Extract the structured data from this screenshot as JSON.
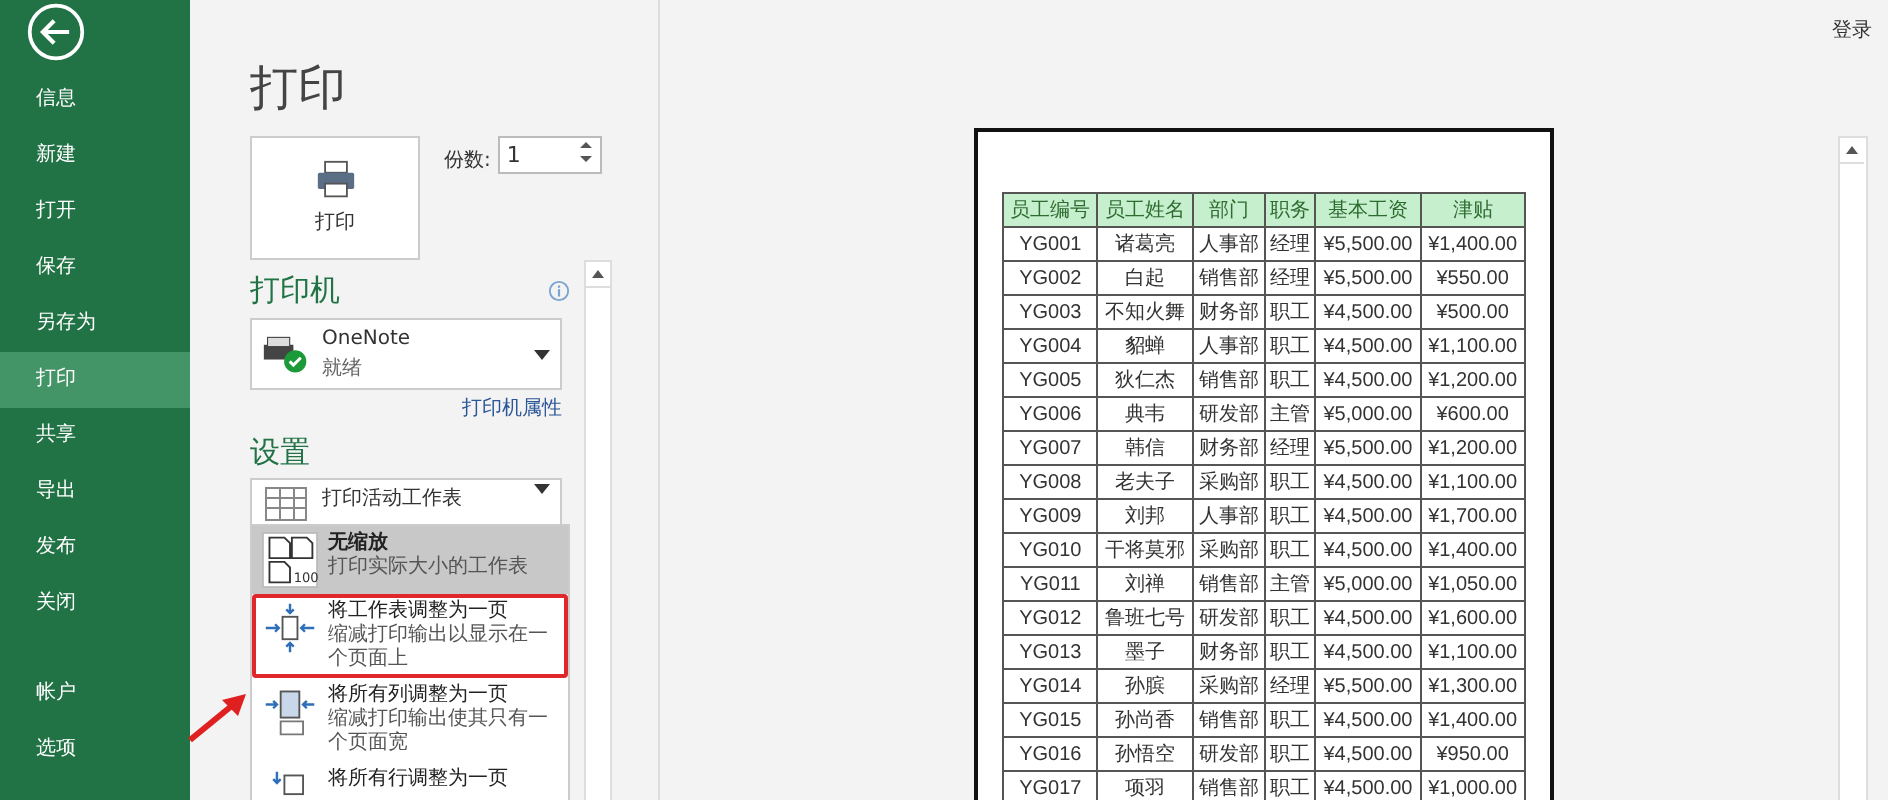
{
  "sidebar": {
    "items": [
      {
        "label": "信息",
        "selected": false
      },
      {
        "label": "新建",
        "selected": false
      },
      {
        "label": "打开",
        "selected": false
      },
      {
        "label": "保存",
        "selected": false
      },
      {
        "label": "另存为",
        "selected": false
      },
      {
        "label": "打印",
        "selected": true
      },
      {
        "label": "共享",
        "selected": false
      },
      {
        "label": "导出",
        "selected": false
      },
      {
        "label": "发布",
        "selected": false
      },
      {
        "label": "关闭",
        "selected": false
      }
    ],
    "bottom_items": [
      {
        "label": "帐户",
        "selected": false
      },
      {
        "label": "选项",
        "selected": false
      }
    ]
  },
  "header": {
    "title": "打印",
    "account": "登录"
  },
  "print_button": {
    "label": "打印"
  },
  "copies": {
    "label": "份数:",
    "value": "1"
  },
  "printer": {
    "heading": "打印机",
    "name": "OneNote",
    "status": "就绪",
    "properties_link": "打印机属性"
  },
  "settings": {
    "heading": "设置",
    "what_dropdown": {
      "title": "打印活动工作表"
    },
    "scaling_options": [
      {
        "kind": "none",
        "title": "无缩放",
        "description": "打印实际大小的工作表",
        "icon_label": "100",
        "selected": true,
        "highlighted": false
      },
      {
        "kind": "sheet",
        "title": "将工作表调整为一页",
        "description": "缩减打印输出以显示在一个页面上",
        "selected": false,
        "highlighted": true
      },
      {
        "kind": "columns",
        "title": "将所有列调整为一页",
        "description": "缩减打印输出使其只有一个页面宽",
        "selected": false,
        "highlighted": false
      },
      {
        "kind": "rows",
        "title": "将所有行调整为一页",
        "selected": false,
        "highlighted": false
      }
    ]
  },
  "preview": {
    "table": {
      "columns": [
        "员工编号",
        "员工姓名",
        "部门",
        "职务",
        "基本工资",
        "津贴"
      ],
      "rows": [
        [
          "YG001",
          "诸葛亮",
          "人事部",
          "经理",
          "¥5,500.00",
          "¥1,400.00"
        ],
        [
          "YG002",
          "白起",
          "销售部",
          "经理",
          "¥5,500.00",
          "¥550.00"
        ],
        [
          "YG003",
          "不知火舞",
          "财务部",
          "职工",
          "¥4,500.00",
          "¥500.00"
        ],
        [
          "YG004",
          "貂蝉",
          "人事部",
          "职工",
          "¥4,500.00",
          "¥1,100.00"
        ],
        [
          "YG005",
          "狄仁杰",
          "销售部",
          "职工",
          "¥4,500.00",
          "¥1,200.00"
        ],
        [
          "YG006",
          "典韦",
          "研发部",
          "主管",
          "¥5,000.00",
          "¥600.00"
        ],
        [
          "YG007",
          "韩信",
          "财务部",
          "经理",
          "¥5,500.00",
          "¥1,200.00"
        ],
        [
          "YG008",
          "老夫子",
          "采购部",
          "职工",
          "¥4,500.00",
          "¥1,100.00"
        ],
        [
          "YG009",
          "刘邦",
          "人事部",
          "职工",
          "¥4,500.00",
          "¥1,700.00"
        ],
        [
          "YG010",
          "干将莫邪",
          "采购部",
          "职工",
          "¥4,500.00",
          "¥1,400.00"
        ],
        [
          "YG011",
          "刘禅",
          "销售部",
          "主管",
          "¥5,000.00",
          "¥1,050.00"
        ],
        [
          "YG012",
          "鲁班七号",
          "研发部",
          "职工",
          "¥4,500.00",
          "¥1,600.00"
        ],
        [
          "YG013",
          "墨子",
          "财务部",
          "职工",
          "¥4,500.00",
          "¥1,100.00"
        ],
        [
          "YG014",
          "孙膑",
          "采购部",
          "经理",
          "¥5,500.00",
          "¥1,300.00"
        ],
        [
          "YG015",
          "孙尚香",
          "销售部",
          "职工",
          "¥4,500.00",
          "¥1,400.00"
        ],
        [
          "YG016",
          "孙悟空",
          "研发部",
          "职工",
          "¥4,500.00",
          "¥950.00"
        ],
        [
          "YG017",
          "项羽",
          "销售部",
          "职工",
          "¥4,500.00",
          "¥1,000.00"
        ]
      ]
    }
  }
}
